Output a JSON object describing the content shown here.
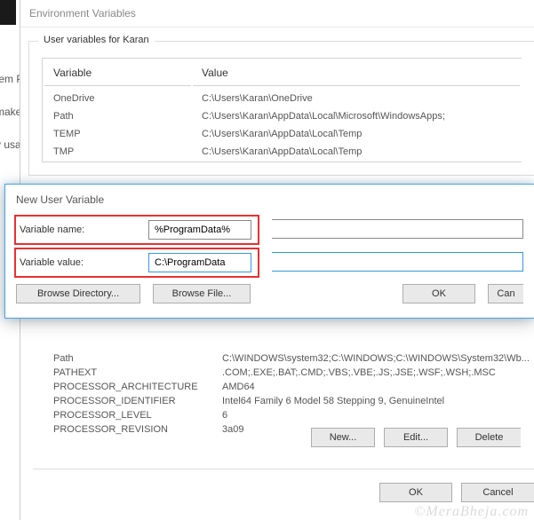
{
  "sidebar_snippets": [
    "tem P",
    "make",
    "y usa"
  ],
  "env_window": {
    "title": "Environment Variables",
    "group_label": "User variables for Karan",
    "columns": {
      "variable": "Variable",
      "value": "Value"
    },
    "user_vars": [
      {
        "name": "OneDrive",
        "value": "C:\\Users\\Karan\\OneDrive"
      },
      {
        "name": "Path",
        "value": "C:\\Users\\Karan\\AppData\\Local\\Microsoft\\WindowsApps;"
      },
      {
        "name": "TEMP",
        "value": "C:\\Users\\Karan\\AppData\\Local\\Temp"
      },
      {
        "name": "TMP",
        "value": "C:\\Users\\Karan\\AppData\\Local\\Temp"
      }
    ]
  },
  "dialog": {
    "title": "New User Variable",
    "name_label": "Variable name:",
    "value_label": "Variable value:",
    "name_input": "%ProgramData%",
    "value_input": "C:\\ProgramData",
    "browse_dir": "Browse Directory...",
    "browse_file": "Browse File...",
    "ok": "OK",
    "cancel": "Can"
  },
  "sys_vars": [
    {
      "name": "Path",
      "value": "C:\\WINDOWS\\system32;C:\\WINDOWS;C:\\WINDOWS\\System32\\Wb..."
    },
    {
      "name": "PATHEXT",
      "value": ".COM;.EXE;.BAT;.CMD;.VBS;.VBE;.JS;.JSE;.WSF;.WSH;.MSC"
    },
    {
      "name": "PROCESSOR_ARCHITECTURE",
      "value": "AMD64"
    },
    {
      "name": "PROCESSOR_IDENTIFIER",
      "value": "Intel64 Family 6 Model 58 Stepping 9, GenuineIntel"
    },
    {
      "name": "PROCESSOR_LEVEL",
      "value": "6"
    },
    {
      "name": "PROCESSOR_REVISION",
      "value": "3a09"
    }
  ],
  "buttons": {
    "new": "New...",
    "edit": "Edit...",
    "delete": "Delete",
    "ok": "OK",
    "cancel": "Cancel"
  },
  "watermark": "©MeraBheja.com"
}
